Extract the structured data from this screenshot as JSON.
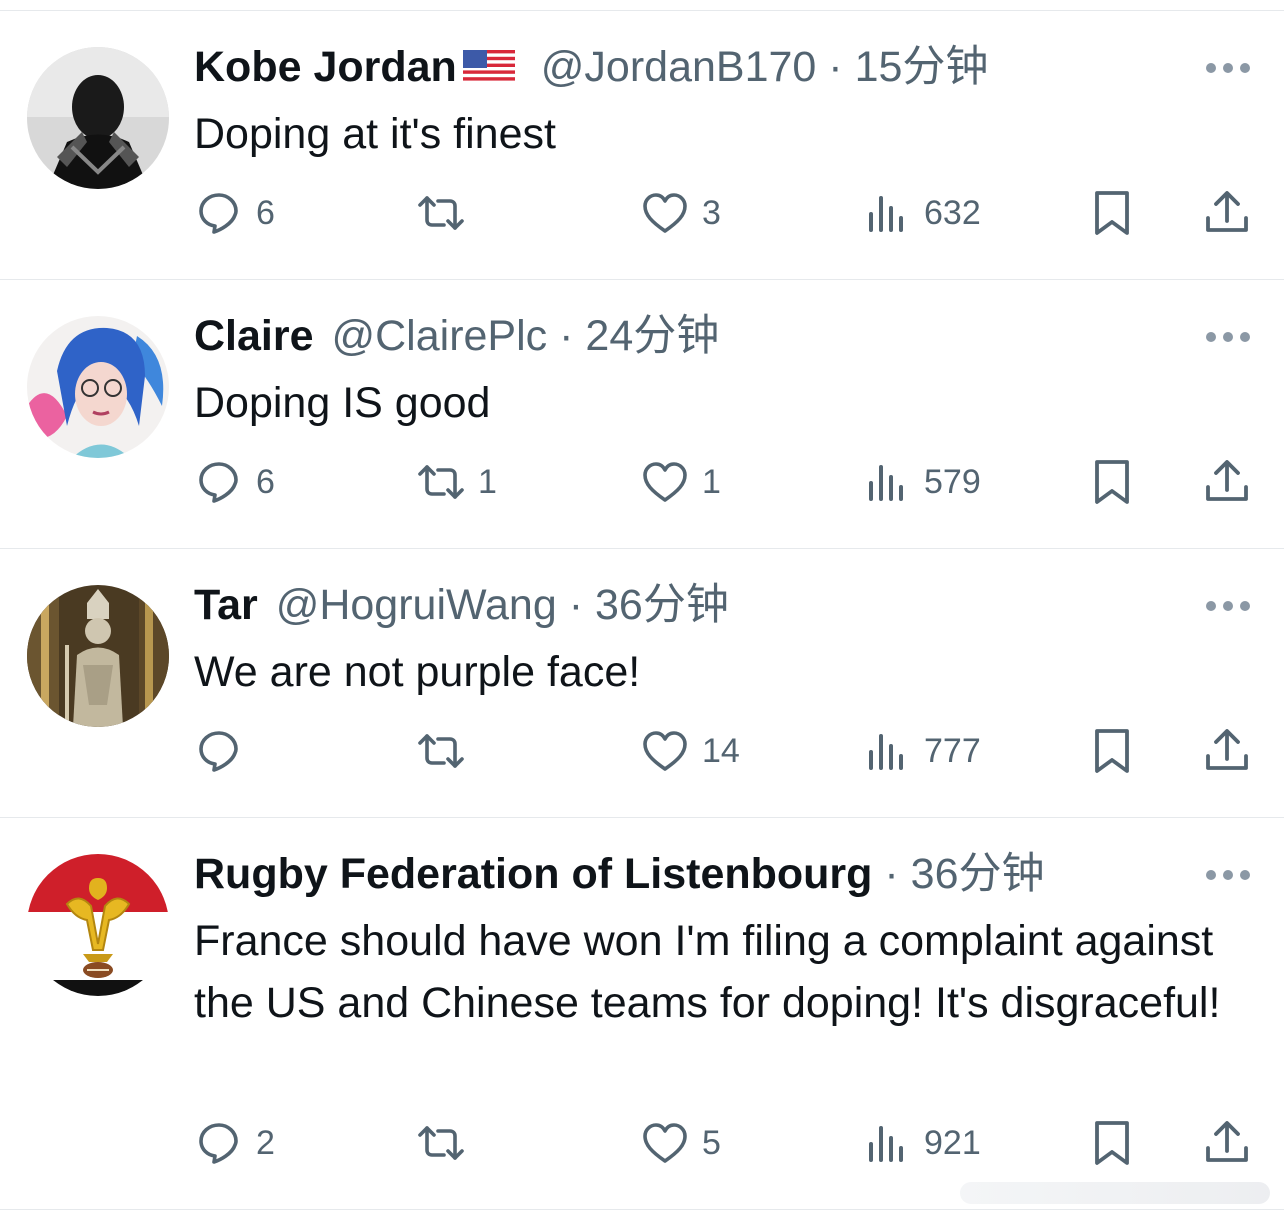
{
  "tweets": [
    {
      "name": "Kobe Jordan",
      "flag_emoji": "🇺🇸",
      "handle": "@JordanB170",
      "dot": "·",
      "time": "15分钟",
      "text": "Doping at it's finest",
      "replies": "6",
      "retweets": "",
      "likes": "3",
      "views": "632"
    },
    {
      "name": "Claire",
      "handle": "@ClairePlc",
      "dot": "·",
      "time": "24分钟",
      "text": "Doping IS good",
      "replies": "6",
      "retweets": "1",
      "likes": "1",
      "views": "579"
    },
    {
      "name": "Tar",
      "handle": "@HogruiWang",
      "dot": "·",
      "time": "36分钟",
      "text": "We are not purple face!",
      "replies": "",
      "retweets": "",
      "likes": "14",
      "views": "777"
    },
    {
      "name": "Rugby Federation of Listenbourg",
      "handle": "",
      "dot": "·",
      "time": "36分钟",
      "text": "France should have won I'm filing a complaint against the US and Chinese teams for doping! It's disgraceful!",
      "replies": "2",
      "retweets": "",
      "likes": "5",
      "views": "921"
    }
  ],
  "icons": {
    "reply": "reply-icon",
    "retweet": "retweet-icon",
    "like": "heart-icon",
    "views": "views-icon",
    "bookmark": "bookmark-icon",
    "share": "share-icon",
    "more": "more-icon"
  },
  "colors": {
    "text": "#0f1419",
    "secondary": "#536471",
    "divider": "#e6e9ec"
  }
}
